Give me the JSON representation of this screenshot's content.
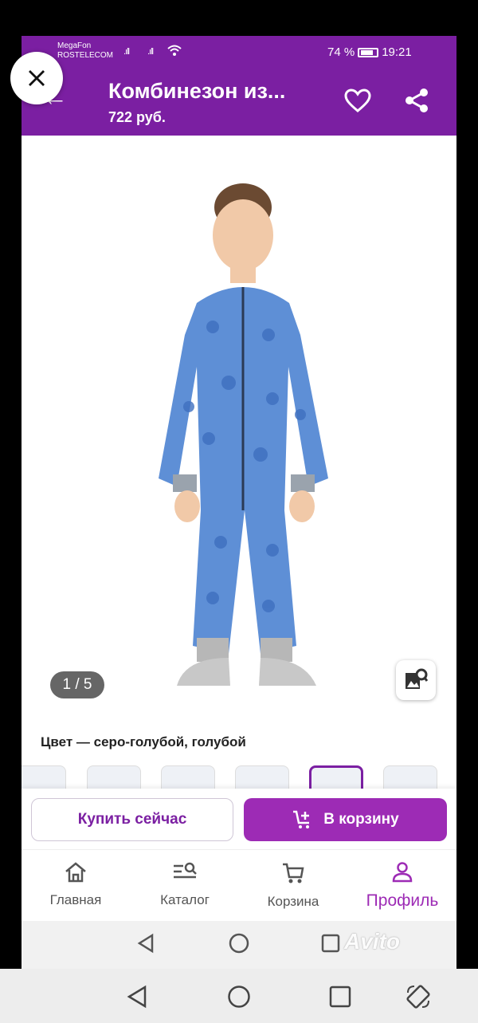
{
  "status_bar": {
    "carrier_1": "MegaFon",
    "carrier_2": "ROSTELECOM",
    "battery": "74 %",
    "time": "19:21"
  },
  "header": {
    "title": "Комбинезон из...",
    "price": "722 руб."
  },
  "gallery": {
    "counter": "1 / 5"
  },
  "color_label": "Цвет — серо-голубой, голубой",
  "actions": {
    "buy_now": "Купить сейчас",
    "to_cart": "В корзину"
  },
  "bottom_nav": {
    "items": [
      {
        "label": "Главная",
        "icon": "home-icon"
      },
      {
        "label": "Каталог",
        "icon": "catalog-search-icon"
      },
      {
        "label": "Корзина",
        "icon": "cart-icon"
      },
      {
        "label": "Профиль",
        "icon": "profile-icon",
        "active": true
      }
    ]
  },
  "watermark": "Avito",
  "colors": {
    "brand": "#7b1fa2",
    "accent": "#9d2bb5"
  }
}
